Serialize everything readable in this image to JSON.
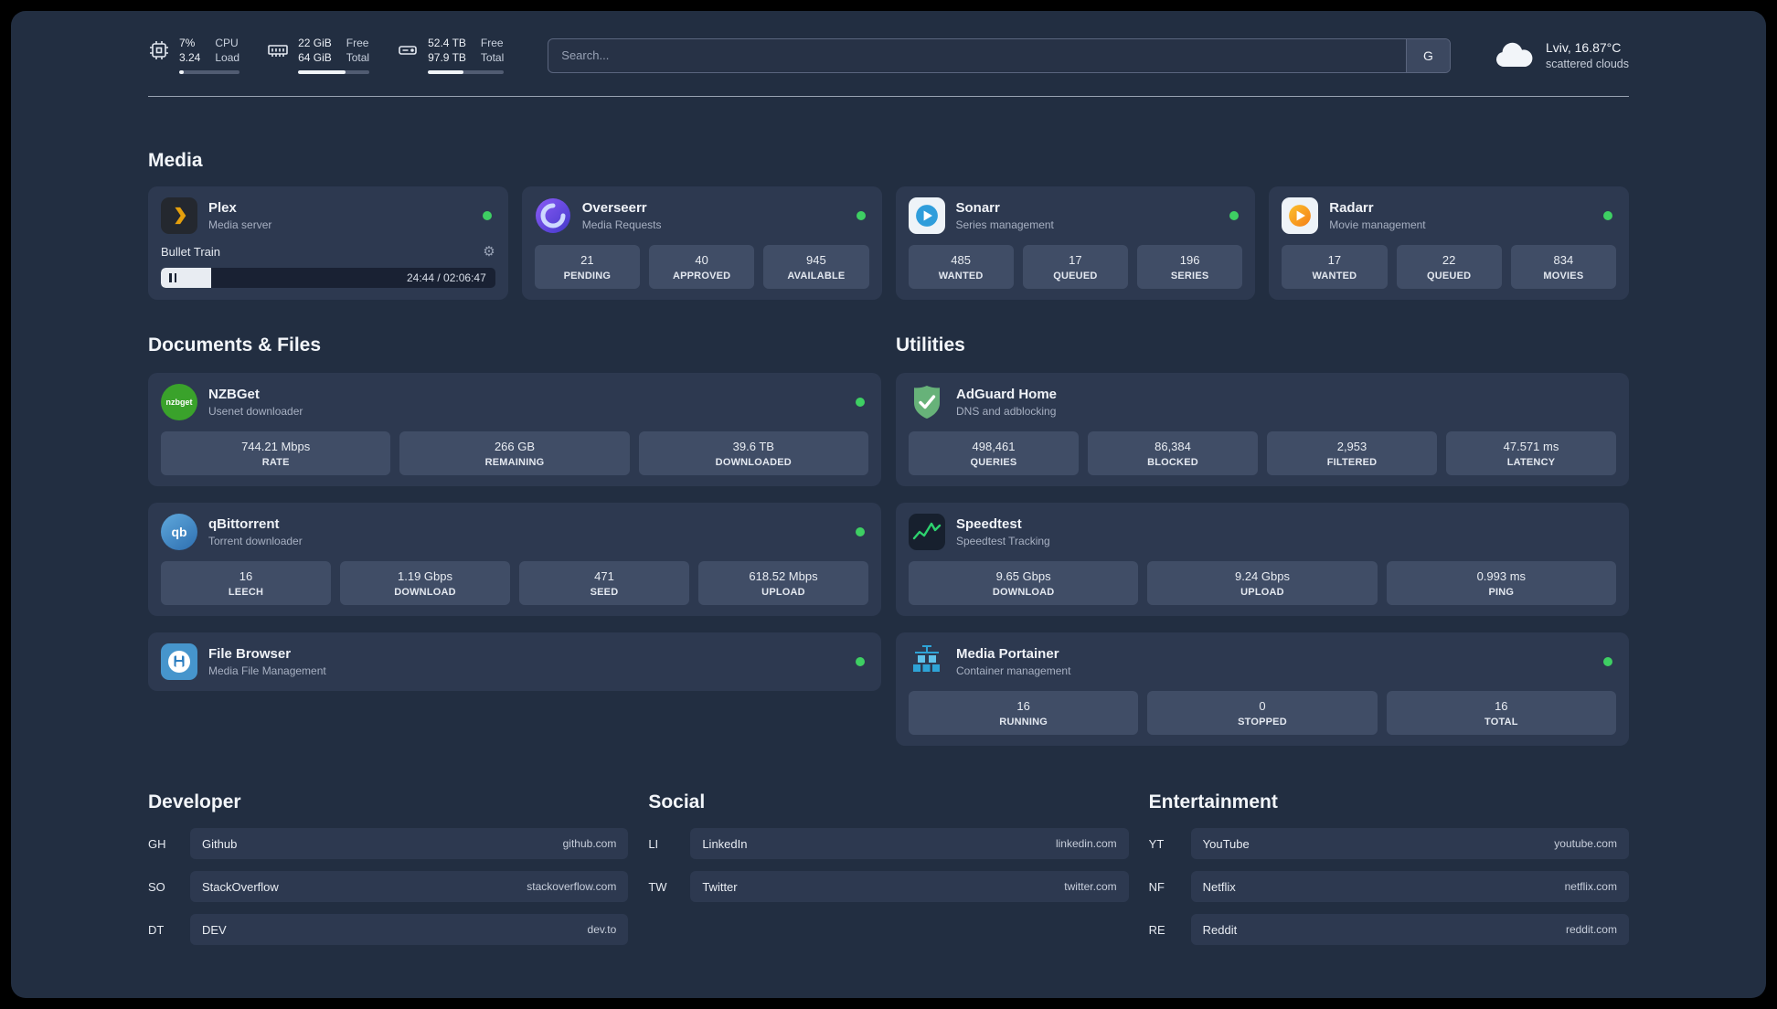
{
  "topbar": {
    "cpu": {
      "value": "7%",
      "load": "3.24",
      "label_top": "CPU",
      "label_bottom": "Load",
      "bar": 7
    },
    "ram": {
      "free": "22 GiB",
      "total": "64 GiB",
      "label_top": "Free",
      "label_bottom": "Total",
      "bar": 66
    },
    "disk": {
      "free": "52.4 TB",
      "total": "97.9 TB",
      "label_top": "Free",
      "label_bottom": "Total",
      "bar": 47
    },
    "search": {
      "placeholder": "Search...",
      "engine": "G"
    },
    "weather": {
      "location": "Lviv, 16.87°C",
      "condition": "scattered clouds"
    }
  },
  "sections": {
    "media": "Media",
    "documents": "Documents & Files",
    "utilities": "Utilities",
    "developer": "Developer",
    "social": "Social",
    "entertainment": "Entertainment"
  },
  "apps": {
    "plex": {
      "name": "Plex",
      "subtitle": "Media server",
      "now_playing": "Bullet Train",
      "time": "24:44 / 02:06:47",
      "progress": 15
    },
    "overseerr": {
      "name": "Overseerr",
      "subtitle": "Media Requests",
      "stats": [
        {
          "value": "21",
          "label": "PENDING"
        },
        {
          "value": "40",
          "label": "APPROVED"
        },
        {
          "value": "945",
          "label": "AVAILABLE"
        }
      ]
    },
    "sonarr": {
      "name": "Sonarr",
      "subtitle": "Series management",
      "stats": [
        {
          "value": "485",
          "label": "WANTED"
        },
        {
          "value": "17",
          "label": "QUEUED"
        },
        {
          "value": "196",
          "label": "SERIES"
        }
      ]
    },
    "radarr": {
      "name": "Radarr",
      "subtitle": "Movie management",
      "stats": [
        {
          "value": "17",
          "label": "WANTED"
        },
        {
          "value": "22",
          "label": "QUEUED"
        },
        {
          "value": "834",
          "label": "MOVIES"
        }
      ]
    },
    "nzbget": {
      "name": "NZBGet",
      "subtitle": "Usenet downloader",
      "stats": [
        {
          "value": "744.21 Mbps",
          "label": "RATE"
        },
        {
          "value": "266 GB",
          "label": "REMAINING"
        },
        {
          "value": "39.6 TB",
          "label": "DOWNLOADED"
        }
      ]
    },
    "qbittorrent": {
      "name": "qBittorrent",
      "subtitle": "Torrent downloader",
      "stats": [
        {
          "value": "16",
          "label": "LEECH"
        },
        {
          "value": "1.19 Gbps",
          "label": "DOWNLOAD"
        },
        {
          "value": "471",
          "label": "SEED"
        },
        {
          "value": "618.52 Mbps",
          "label": "UPLOAD"
        }
      ]
    },
    "filebrowser": {
      "name": "File Browser",
      "subtitle": "Media File Management"
    },
    "adguard": {
      "name": "AdGuard Home",
      "subtitle": "DNS and adblocking",
      "stats": [
        {
          "value": "498,461",
          "label": "QUERIES"
        },
        {
          "value": "86,384",
          "label": "BLOCKED"
        },
        {
          "value": "2,953",
          "label": "FILTERED"
        },
        {
          "value": "47.571 ms",
          "label": "LATENCY"
        }
      ]
    },
    "speedtest": {
      "name": "Speedtest",
      "subtitle": "Speedtest Tracking",
      "stats": [
        {
          "value": "9.65 Gbps",
          "label": "DOWNLOAD"
        },
        {
          "value": "9.24 Gbps",
          "label": "UPLOAD"
        },
        {
          "value": "0.993 ms",
          "label": "PING"
        }
      ]
    },
    "portainer": {
      "name": "Media Portainer",
      "subtitle": "Container management",
      "stats": [
        {
          "value": "16",
          "label": "RUNNING"
        },
        {
          "value": "0",
          "label": "STOPPED"
        },
        {
          "value": "16",
          "label": "TOTAL"
        }
      ]
    }
  },
  "bookmarks": {
    "developer": {
      "items": [
        {
          "abbr": "GH",
          "name": "Github",
          "url": "github.com"
        },
        {
          "abbr": "SO",
          "name": "StackOverflow",
          "url": "stackoverflow.com"
        },
        {
          "abbr": "DT",
          "name": "DEV",
          "url": "dev.to"
        }
      ]
    },
    "social": {
      "items": [
        {
          "abbr": "LI",
          "name": "LinkedIn",
          "url": "linkedin.com"
        },
        {
          "abbr": "TW",
          "name": "Twitter",
          "url": "twitter.com"
        }
      ]
    },
    "entertainment": {
      "items": [
        {
          "abbr": "YT",
          "name": "YouTube",
          "url": "youtube.com"
        },
        {
          "abbr": "NF",
          "name": "Netflix",
          "url": "netflix.com"
        },
        {
          "abbr": "RE",
          "name": "Reddit",
          "url": "reddit.com"
        }
      ]
    }
  },
  "icons": {
    "nzbget_label": "nzbget",
    "qbittorrent_label": "qb"
  }
}
